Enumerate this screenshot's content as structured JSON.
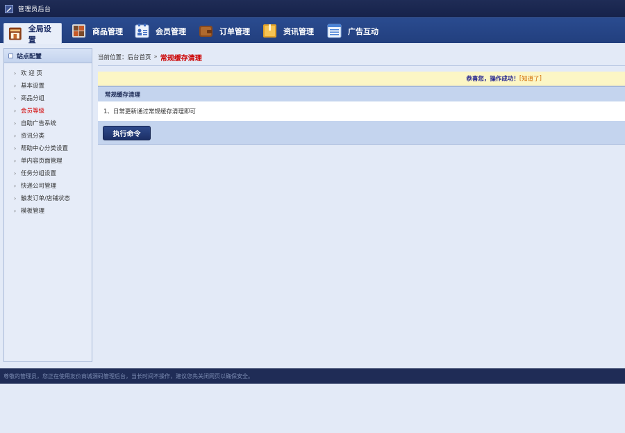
{
  "app": {
    "title": "管理员后台"
  },
  "nav": {
    "items": [
      {
        "label": "全局设置",
        "icon": "store-icon",
        "active": true
      },
      {
        "label": "商品管理",
        "icon": "product-grid-icon"
      },
      {
        "label": "会员管理",
        "icon": "member-card-icon"
      },
      {
        "label": "订单管理",
        "icon": "wallet-icon"
      },
      {
        "label": "资讯管理",
        "icon": "news-box-icon"
      },
      {
        "label": "广告互动",
        "icon": "ad-list-icon"
      }
    ]
  },
  "sidebar": {
    "title": "站点配置",
    "items": [
      {
        "label": "欢 迎 页"
      },
      {
        "label": "基本设置"
      },
      {
        "label": "商品分组"
      },
      {
        "label": "会员等级",
        "active": true
      },
      {
        "label": "自助广告系统"
      },
      {
        "label": "资讯分类"
      },
      {
        "label": "帮助中心分类设置"
      },
      {
        "label": "单内容页面管理"
      },
      {
        "label": "任务分组设置"
      },
      {
        "label": "快递公司管理"
      },
      {
        "label": "触发订单/店铺状态"
      },
      {
        "label": "模板管理"
      }
    ]
  },
  "breadcrumb": {
    "prefix": "当前位置：",
    "home": "后台首页",
    "separator": "»",
    "current": "常规缓存清理"
  },
  "notice": {
    "message": "恭喜您，操作成功！",
    "bracket_open": "[",
    "link": "知道了",
    "bracket_close": "]"
  },
  "panel": {
    "title": "常规缓存清理",
    "body": "1、日常更新通过常规缓存清理即可",
    "button": "执行命令"
  },
  "footer": {
    "text": "尊敬的管理员，您正在使用友价商城源码管理后台，当长时间不操作，建议您先关闭网页以确保安全。"
  },
  "colors": {
    "header_bg": "#1f2c56",
    "nav_bg": "#2a4b8f",
    "panel_bg": "#c4d4ee",
    "notice_bg": "#fcf6c5",
    "active_link": "#d40000"
  }
}
